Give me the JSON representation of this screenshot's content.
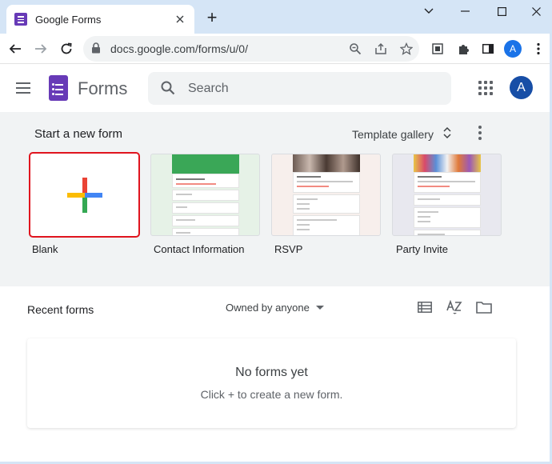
{
  "browser": {
    "tab_title": "Google Forms",
    "new_tab": "+",
    "url": "docs.google.com/forms/u/0/",
    "profile_initial": "A"
  },
  "app": {
    "title": "Forms",
    "search_placeholder": "Search",
    "account_initial": "A"
  },
  "new_form": {
    "section_title": "Start a new form",
    "template_gallery": "Template gallery",
    "templates": [
      {
        "label": "Blank"
      },
      {
        "label": "Contact Information"
      },
      {
        "label": "RSVP"
      },
      {
        "label": "Party Invite"
      }
    ]
  },
  "recent": {
    "title": "Recent forms",
    "owner_filter": "Owned by anyone",
    "empty_title": "No forms yet",
    "empty_subtitle": "Click + to create a new form."
  },
  "colors": {
    "forms_purple": "#673ab7",
    "accent_blue": "#1a73e8",
    "blank_highlight": "#e0141e",
    "chrome_tab_strip": "#d5e5f6"
  }
}
